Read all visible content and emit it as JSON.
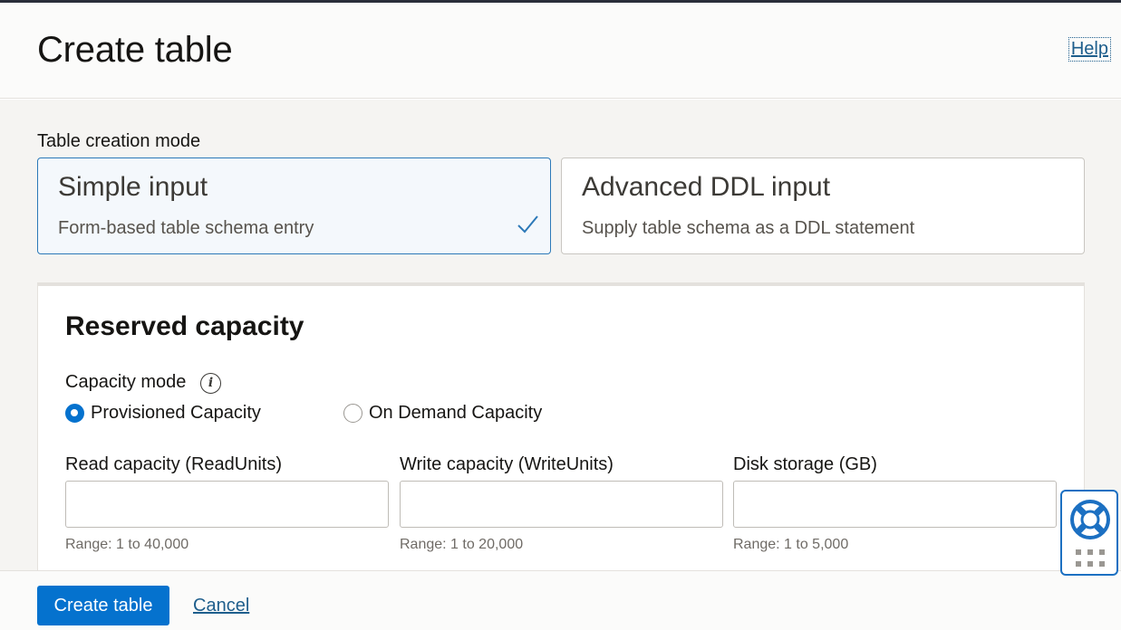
{
  "header": {
    "title": "Create table",
    "help_label": "Help"
  },
  "creation_mode": {
    "label": "Table creation mode",
    "options": [
      {
        "title": "Simple input",
        "description": "Form-based table schema entry",
        "selected": true
      },
      {
        "title": "Advanced DDL input",
        "description": "Supply table schema as a DDL statement",
        "selected": false
      }
    ]
  },
  "reserved_capacity": {
    "title": "Reserved capacity",
    "capacity_mode_label": "Capacity mode",
    "capacity_modes": [
      {
        "label": "Provisioned Capacity",
        "checked": true
      },
      {
        "label": "On Demand Capacity",
        "checked": false
      }
    ],
    "fields": [
      {
        "label": "Read capacity (ReadUnits)",
        "value": "",
        "hint": "Range: 1 to 40,000"
      },
      {
        "label": "Write capacity (WriteUnits)",
        "value": "",
        "hint": "Range: 1 to 20,000"
      },
      {
        "label": "Disk storage (GB)",
        "value": "",
        "hint": "Range: 1 to 5,000"
      }
    ]
  },
  "footer": {
    "create_label": "Create table",
    "cancel_label": "Cancel"
  },
  "colors": {
    "accent": "#0572ce",
    "link": "#1e5e8c",
    "selected_border": "#2c79b8"
  },
  "icons": {
    "check": "check-icon",
    "info": "info-icon",
    "help_widget": "lifebuoy-icon"
  }
}
